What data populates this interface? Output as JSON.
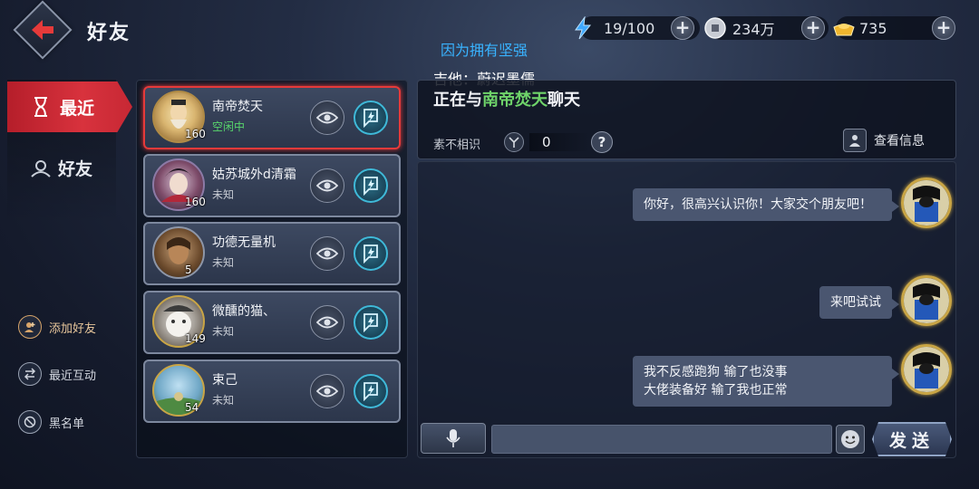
{
  "header": {
    "title": "好友",
    "back_icon": "back-arrow-icon"
  },
  "resources": [
    {
      "name": "stamina",
      "icon": "lightning-icon",
      "value": "19/100"
    },
    {
      "name": "silver",
      "icon": "coin-icon",
      "value": "234万"
    },
    {
      "name": "gold",
      "icon": "gold-ingot-icon",
      "value": "735"
    }
  ],
  "banner": {
    "line1": "因为拥有坚强",
    "line2": "吉他：蔚迟墨儒"
  },
  "nav": {
    "recent": "最近",
    "friends": "好友"
  },
  "side_actions": {
    "add_friend": "添加好友",
    "recent_interaction": "最近互动",
    "blacklist": "黑名单"
  },
  "friends": [
    {
      "name": "南帝焚天",
      "status": "空闲中",
      "level": "160"
    },
    {
      "name": "姑苏城外d清霜",
      "status": "未知",
      "level": "160"
    },
    {
      "name": "功德无量机",
      "status": "未知",
      "level": "5"
    },
    {
      "name": "微醺的猫、",
      "status": "未知",
      "level": "149"
    },
    {
      "name": "束己",
      "status": "未知",
      "level": "54"
    }
  ],
  "chat": {
    "title_prefix": "正在与",
    "title_name": "南帝焚天",
    "title_suffix": "聊天",
    "relation_label": "素不相识",
    "relation_value": "0",
    "help": "?",
    "view_info": "查看信息",
    "messages": [
      {
        "text": "你好，很高兴认识你！大家交个朋友吧！"
      },
      {
        "text": "来吧试试"
      },
      {
        "line1": "我不反感跑狗 输了也没事",
        "line2": "大佬装备好 输了我也正常"
      }
    ],
    "input_placeholder": "",
    "send": "发送"
  },
  "colors": {
    "accent_red": "#d8323d",
    "online_green": "#58d66c",
    "highlight_green": "#6fd46a",
    "banner_blue": "#39b3ff",
    "gold_border": "#c9a545"
  }
}
